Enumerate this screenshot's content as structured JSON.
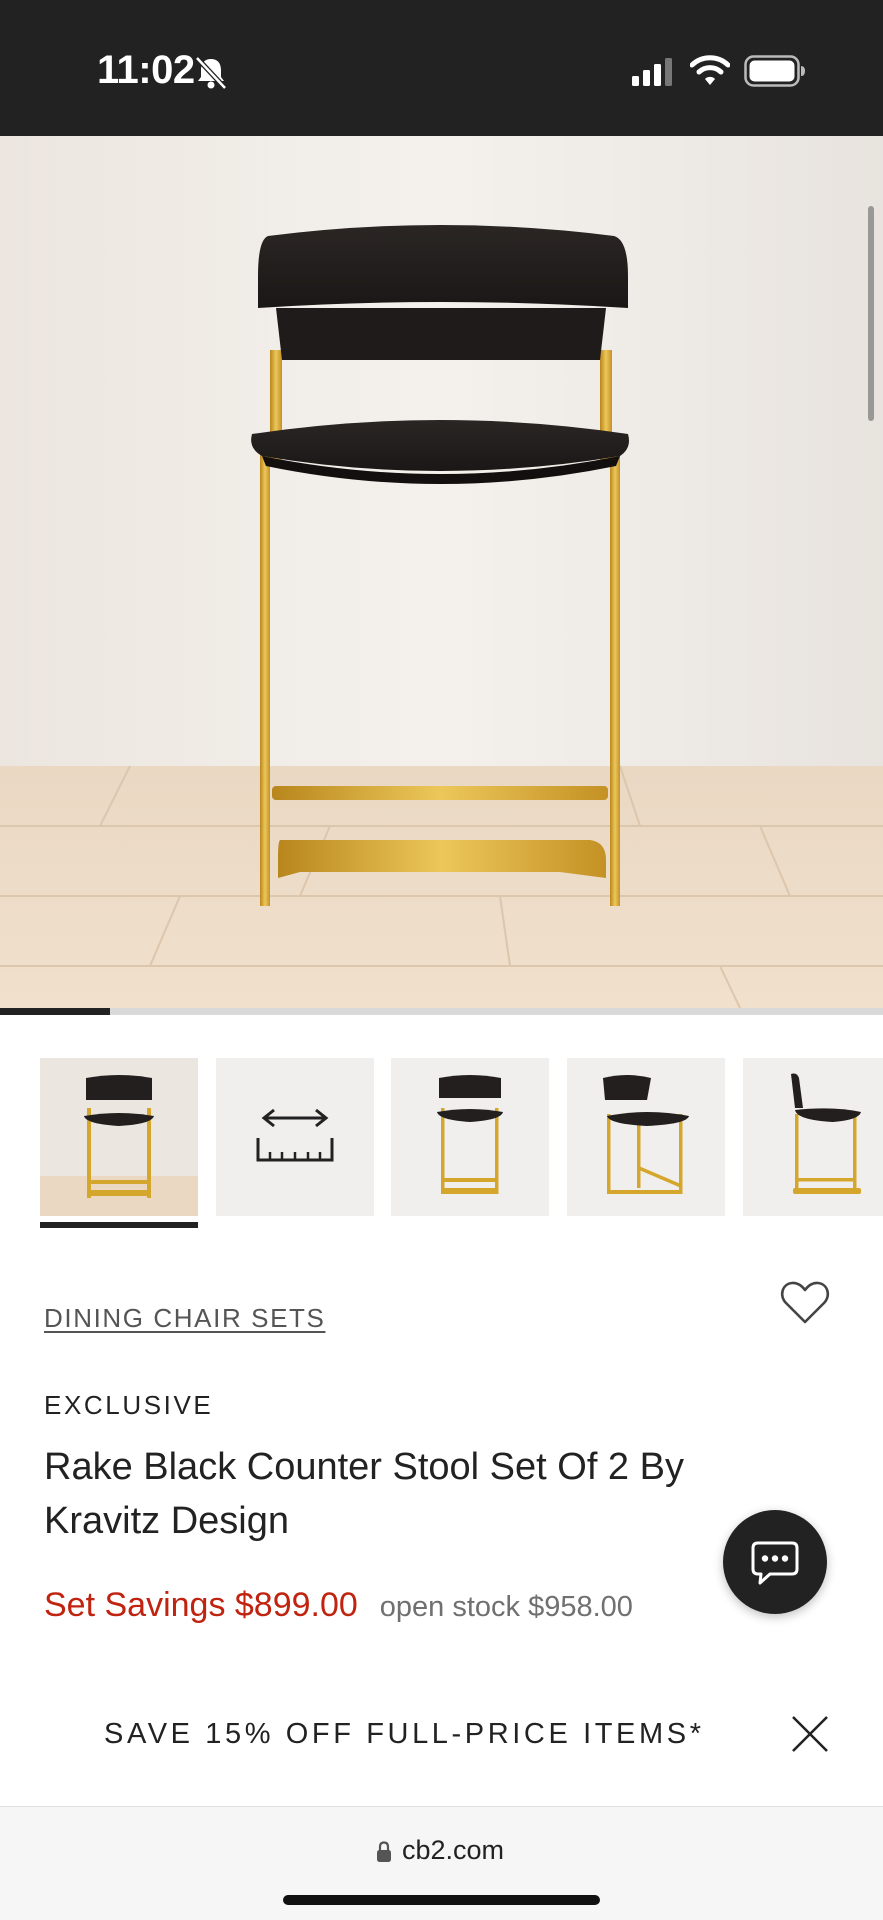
{
  "status_bar": {
    "time": "11:02",
    "icons": [
      "bell-slash-icon",
      "cellular-signal-icon",
      "wifi-icon",
      "battery-icon"
    ]
  },
  "gallery": {
    "main_image": "Rake black counter stool with brass base",
    "progress_fraction": 0.125,
    "thumbnails": [
      {
        "name": "thumb-front-room",
        "active": true
      },
      {
        "name": "thumb-dimensions",
        "icon": "ruler-dimensions-icon"
      },
      {
        "name": "thumb-front-studio"
      },
      {
        "name": "thumb-angle"
      },
      {
        "name": "thumb-side"
      }
    ]
  },
  "product": {
    "category": "DINING CHAIR SETS",
    "badge": "EXCLUSIVE",
    "title": "Rake Black Counter Stool Set Of 2 By Kravitz Design",
    "set_price": "Set Savings $899.00",
    "open_stock_price": "open stock $958.00"
  },
  "promo": {
    "text": "SAVE 15% OFF FULL-PRICE ITEMS*"
  },
  "browser": {
    "url": "cb2.com"
  },
  "colors": {
    "sale_red": "#c0230f",
    "dark": "#222222",
    "brass": "#d4a72c"
  }
}
